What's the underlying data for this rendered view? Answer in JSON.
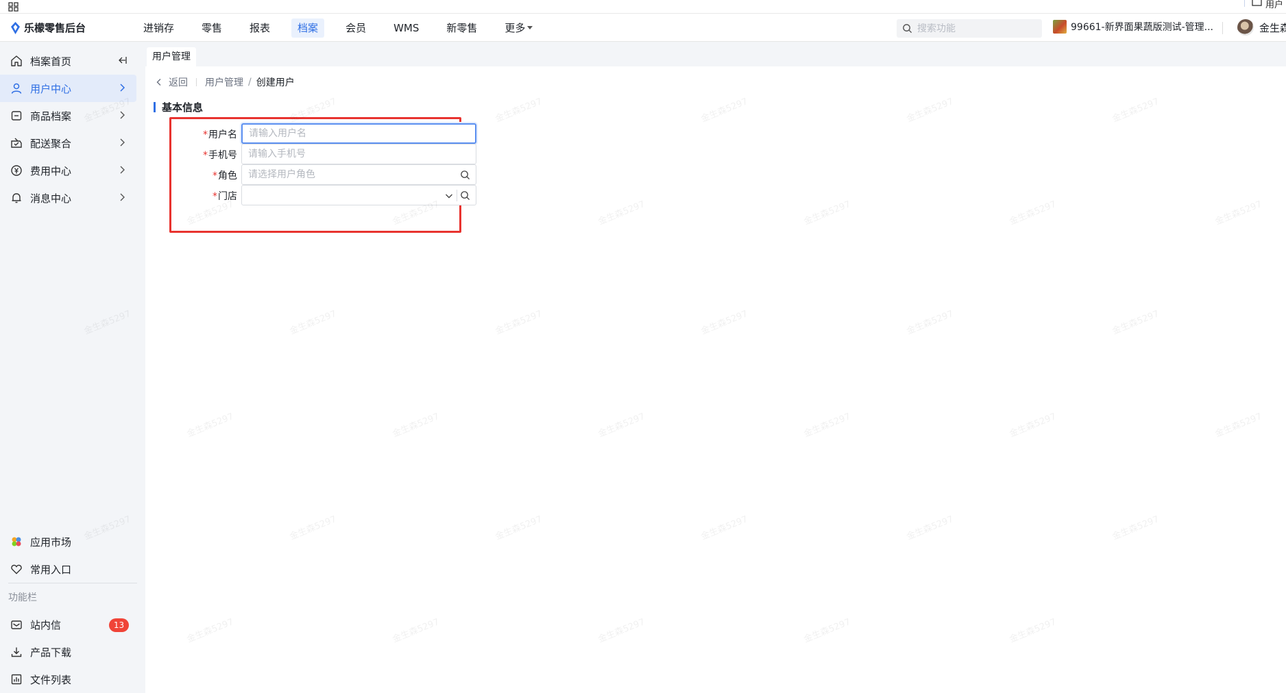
{
  "topstrip": {
    "right_text": "用户"
  },
  "header": {
    "brand": "乐檬零售后台",
    "nav": [
      {
        "label": "进销存",
        "active": false
      },
      {
        "label": "零售",
        "active": false
      },
      {
        "label": "报表",
        "active": false
      },
      {
        "label": "档案",
        "active": true
      },
      {
        "label": "会员",
        "active": false
      },
      {
        "label": "WMS",
        "active": false
      },
      {
        "label": "新零售",
        "active": false
      },
      {
        "label": "更多",
        "active": false
      }
    ],
    "search_placeholder": "搜索功能",
    "store_name": "99661-新界面果蔬版测试-管理...",
    "user_name": "金生森"
  },
  "sidebar": {
    "items": [
      {
        "label": "档案首页",
        "icon": "home-icon"
      },
      {
        "label": "用户中心",
        "icon": "user-icon",
        "active": true
      },
      {
        "label": "商品档案",
        "icon": "box-icon"
      },
      {
        "label": "配送聚合",
        "icon": "delivery-icon"
      },
      {
        "label": "费用中心",
        "icon": "yen-coin-icon"
      },
      {
        "label": "消息中心",
        "icon": "bell-icon"
      }
    ],
    "bottom_items": [
      {
        "label": "应用市场",
        "icon": "app-market-icon"
      },
      {
        "label": "常用入口",
        "icon": "heart-icon"
      }
    ],
    "group_label": "功能栏",
    "tool_items": [
      {
        "label": "站内信",
        "icon": "mail-icon",
        "badge": "13"
      },
      {
        "label": "产品下载",
        "icon": "download-icon"
      },
      {
        "label": "文件列表",
        "icon": "file-list-icon"
      }
    ]
  },
  "main": {
    "tab": "用户管理",
    "breadcrumb": {
      "back": "返回",
      "parent": "用户管理",
      "current": "创建用户"
    },
    "section_title": "基本信息",
    "form": {
      "username": {
        "label": "用户名",
        "placeholder": "请输入用户名"
      },
      "phone": {
        "label": "手机号",
        "placeholder": "请输入手机号"
      },
      "role": {
        "label": "角色",
        "placeholder": "请选择用户角色"
      },
      "store": {
        "label": "门店",
        "placeholder": ""
      }
    }
  },
  "watermark": "金生森5297",
  "colors": {
    "accent": "#2f6fe4",
    "highlight_border": "#e8332f",
    "badge": "#f04438",
    "sidebar_bg": "#f3f5f8"
  }
}
